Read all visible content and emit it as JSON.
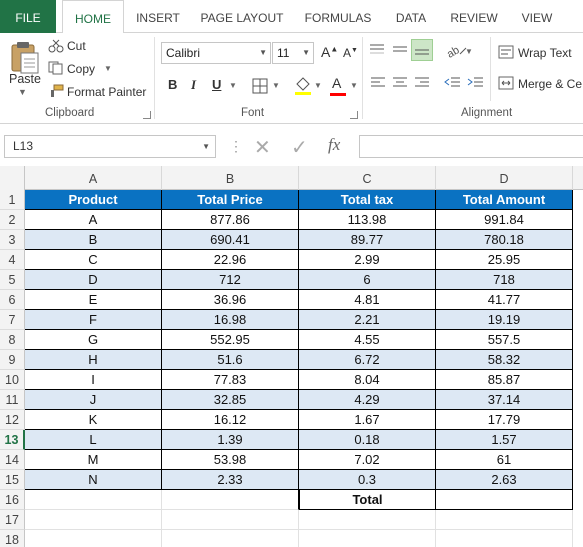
{
  "tabs": [
    "FILE",
    "HOME",
    "INSERT",
    "PAGE LAYOUT",
    "FORMULAS",
    "DATA",
    "REVIEW",
    "VIEW"
  ],
  "clipboard": {
    "paste": "Paste",
    "cut": "Cut",
    "copy": "Copy",
    "format_painter": "Format Painter",
    "group": "Clipboard"
  },
  "font": {
    "name": "Calibri",
    "size": "11",
    "bold": "B",
    "italic": "I",
    "underline": "U",
    "grow": "A",
    "shrink": "A",
    "font_color": "A",
    "group": "Font"
  },
  "alignment": {
    "wrap_text": "Wrap Text",
    "merge": "Merge & Ce",
    "group": "Alignment"
  },
  "formula_bar": {
    "name_box": "L13",
    "fx": "fx",
    "value": ""
  },
  "columns": [
    "A",
    "B",
    "C",
    "D"
  ],
  "row_numbers": [
    "1",
    "2",
    "3",
    "4",
    "5",
    "6",
    "7",
    "8",
    "9",
    "10",
    "11",
    "12",
    "13",
    "14",
    "15",
    "16",
    "17",
    "18"
  ],
  "selected_row": "13",
  "table": {
    "headers": [
      "Product",
      "Total Price",
      "Total tax",
      "Total Amount"
    ],
    "rows": [
      [
        "A",
        "877.86",
        "113.98",
        "991.84"
      ],
      [
        "B",
        "690.41",
        "89.77",
        "780.18"
      ],
      [
        "C",
        "22.96",
        "2.99",
        "25.95"
      ],
      [
        "D",
        "712",
        "6",
        "718"
      ],
      [
        "E",
        "36.96",
        "4.81",
        "41.77"
      ],
      [
        "F",
        "16.98",
        "2.21",
        "19.19"
      ],
      [
        "G",
        "552.95",
        "4.55",
        "557.5"
      ],
      [
        "H",
        "51.6",
        "6.72",
        "58.32"
      ],
      [
        "I",
        "77.83",
        "8.04",
        "85.87"
      ],
      [
        "J",
        "32.85",
        "4.29",
        "37.14"
      ],
      [
        "K",
        "16.12",
        "1.67",
        "17.79"
      ],
      [
        "L",
        "1.39",
        "0.18",
        "1.57"
      ],
      [
        "M",
        "53.98",
        "7.02",
        "61"
      ],
      [
        "N",
        "2.33",
        "0.3",
        "2.63"
      ]
    ],
    "total_label": "Total"
  },
  "colors": {
    "excel_green": "#217346",
    "header_blue": "#0a72c2",
    "band_blue": "#dde8f4"
  }
}
